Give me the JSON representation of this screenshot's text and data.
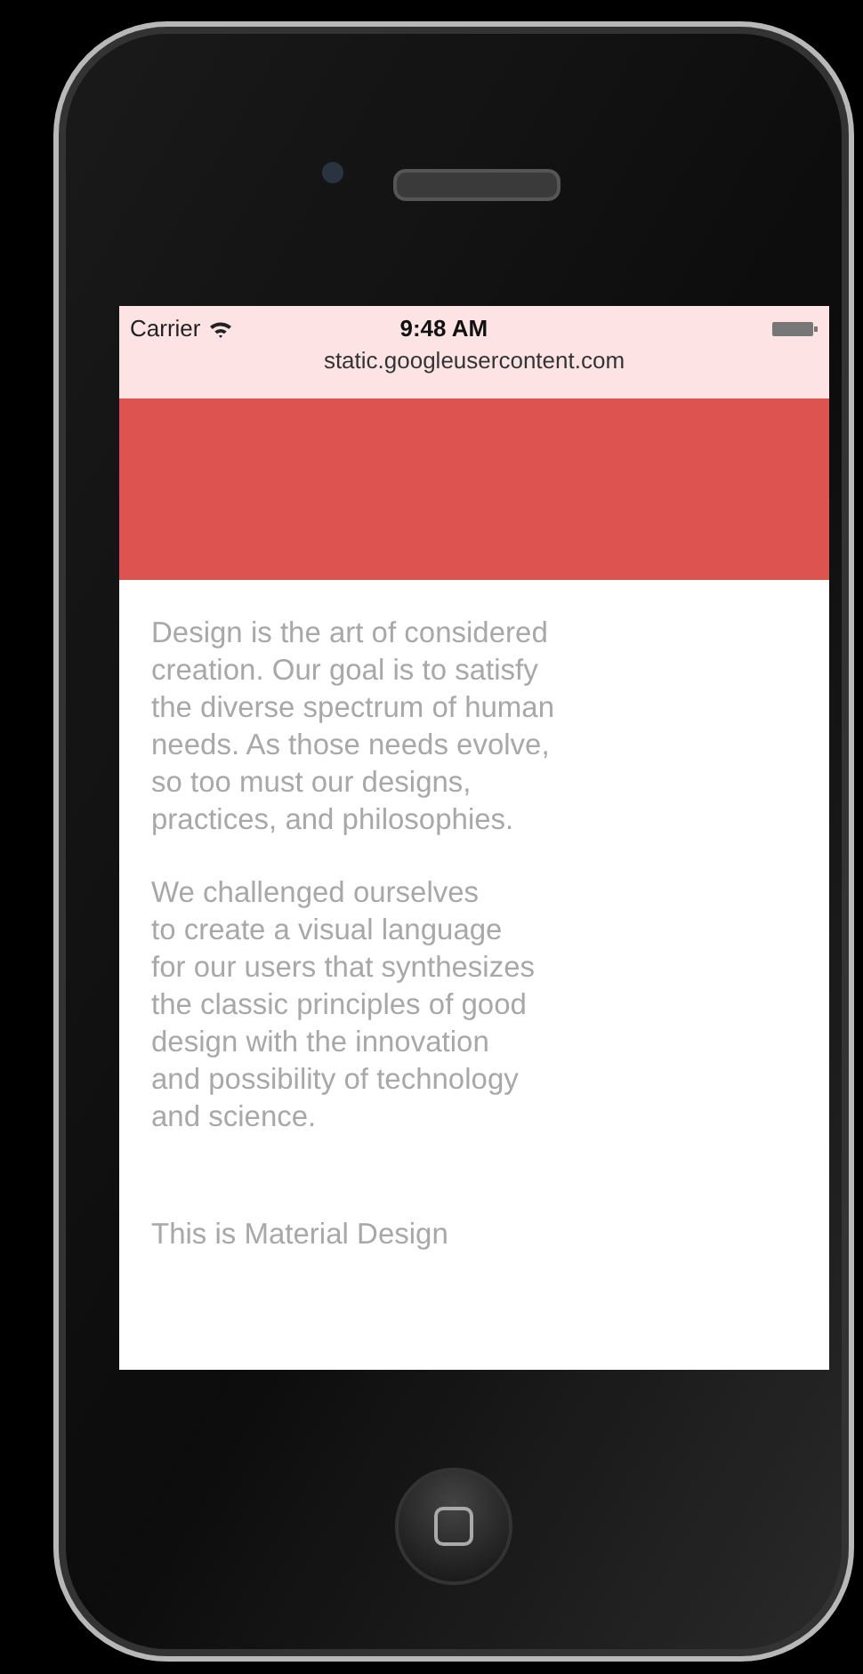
{
  "status_bar": {
    "carrier": "Carrier",
    "time": "9:48 AM",
    "url": "static.googleusercontent.com"
  },
  "content": {
    "paragraphs": [
      "Design is the art of considered\ncreation. Our goal is to satisfy\nthe diverse spectrum of human\nneeds. As those needs evolve,\nso too must our designs,\npractices, and philosophies.",
      "We challenged ourselves\nto create a visual language\nfor our users that synthesizes\nthe classic principles of good\ndesign with the innovation\nand possibility of technology\nand science."
    ],
    "tagline": "This is Material Design"
  }
}
